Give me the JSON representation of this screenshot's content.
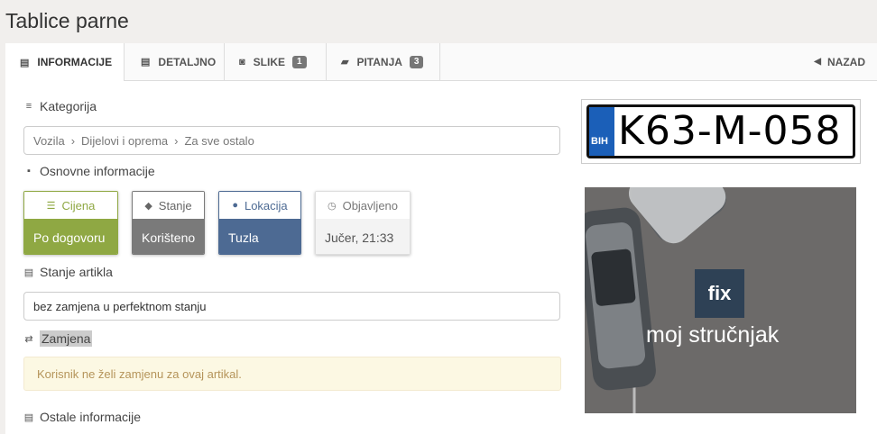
{
  "page": {
    "title": "Tablice parne"
  },
  "tabs": [
    {
      "label": "INFORMACIJE",
      "icon": "id-card-icon"
    },
    {
      "label": "DETALJNO",
      "icon": "document-icon"
    },
    {
      "label": "SLIKE",
      "icon": "camera-icon",
      "badge": "1"
    },
    {
      "label": "PITANJA",
      "icon": "comments-icon",
      "badge": "3"
    }
  ],
  "back": {
    "label": "NAZAD"
  },
  "sections": {
    "kategorija": "Kategorija",
    "osnovne": "Osnovne informacije",
    "stanje_artikla": "Stanje artikla",
    "zamjena": "Zamjena",
    "ostale": "Ostale informacije"
  },
  "breadcrumb": [
    "Vozila",
    "Dijelovi i oprema",
    "Za sve ostalo"
  ],
  "cards": {
    "cijena": {
      "label": "Cijena",
      "value": "Po dogovoru",
      "color": "#8fa843"
    },
    "stanje": {
      "label": "Stanje",
      "value": "Korišteno",
      "color": "#7a7a7a"
    },
    "lokacija": {
      "label": "Lokacija",
      "value": "Tuzla",
      "color": "#4d6a93"
    },
    "objavljeno": {
      "label": "Objavljeno",
      "value": "Jučer, 21:33"
    }
  },
  "stanje_text": "bez zamjena u perfektnom stanju",
  "zamjena_alert": "Korisnik ne želi zamjenu za ovaj artikal.",
  "plate": {
    "number": "K63-M-058",
    "country": "BIH"
  },
  "ad": {
    "logo": "fix",
    "slogan": "moj stručnjak"
  }
}
